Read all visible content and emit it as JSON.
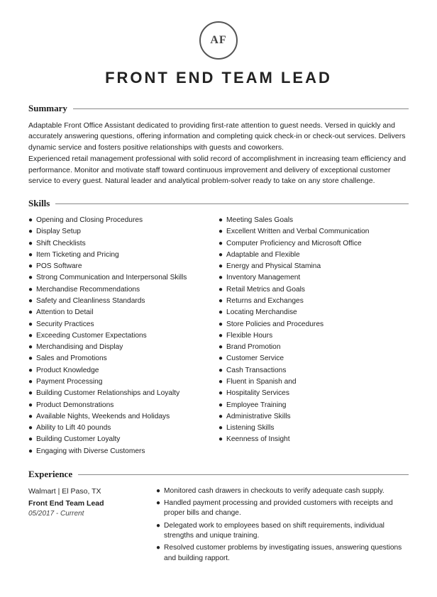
{
  "header": {
    "initials": "AF",
    "title": "FRONT END TEAM LEAD"
  },
  "summary": {
    "label": "Summary",
    "text": "Adaptable Front Office Assistant dedicated to providing first-rate attention to guest needs. Versed in quickly and accurately answering questions, offering information and completing quick check-in or check-out services. Delivers dynamic service and fosters positive relationships with guests and coworkers.\nExperienced retail management professional with solid record of accomplishment in increasing team efficiency and performance. Monitor and motivate staff toward continuous improvement and delivery of exceptional customer service to every guest. Natural leader and analytical problem-solver ready to take on any store challenge."
  },
  "skills": {
    "label": "Skills",
    "left": [
      "Opening and Closing Procedures",
      "Display Setup",
      "Shift Checklists",
      "Item Ticketing and Pricing",
      "POS Software",
      "Strong Communication and Interpersonal Skills",
      "Merchandise Recommendations",
      "Safety and Cleanliness Standards",
      "Attention to Detail",
      "Security Practices",
      "Exceeding Customer Expectations",
      "Merchandising and Display",
      "Sales and Promotions",
      "Product Knowledge",
      "Payment Processing",
      "Building Customer Relationships and Loyalty",
      "Product Demonstrations",
      "Available Nights, Weekends and Holidays",
      "Ability to Lift 40 pounds",
      "Building Customer Loyalty",
      "Engaging with Diverse Customers"
    ],
    "right": [
      "Meeting Sales Goals",
      "Excellent Written and Verbal Communication",
      "Computer Proficiency and Microsoft Office",
      "Adaptable and Flexible",
      "Energy and Physical Stamina",
      "Inventory Management",
      "Retail Metrics and Goals",
      "Returns and Exchanges",
      "Locating Merchandise",
      "Store Policies and Procedures",
      "Flexible Hours",
      "Brand Promotion",
      "Customer Service",
      "Cash Transactions",
      "Fluent in Spanish and",
      "Hospitality Services",
      "Employee Training",
      "Administrative Skills",
      "Listening Skills",
      "Keenness of Insight"
    ]
  },
  "experience": {
    "label": "Experience",
    "jobs": [
      {
        "company": "Walmart | El Paso, TX",
        "title": "Front End Team Lead",
        "dates": "05/2017 - Current",
        "bullets": [
          "Monitored cash drawers in checkouts to verify adequate cash supply.",
          "Handled payment processing and provided customers with receipts and proper bills and change.",
          "Delegated work to employees based on shift requirements, individual strengths and unique training.",
          "Resolved customer problems by investigating issues, answering questions and building rapport."
        ]
      }
    ]
  }
}
